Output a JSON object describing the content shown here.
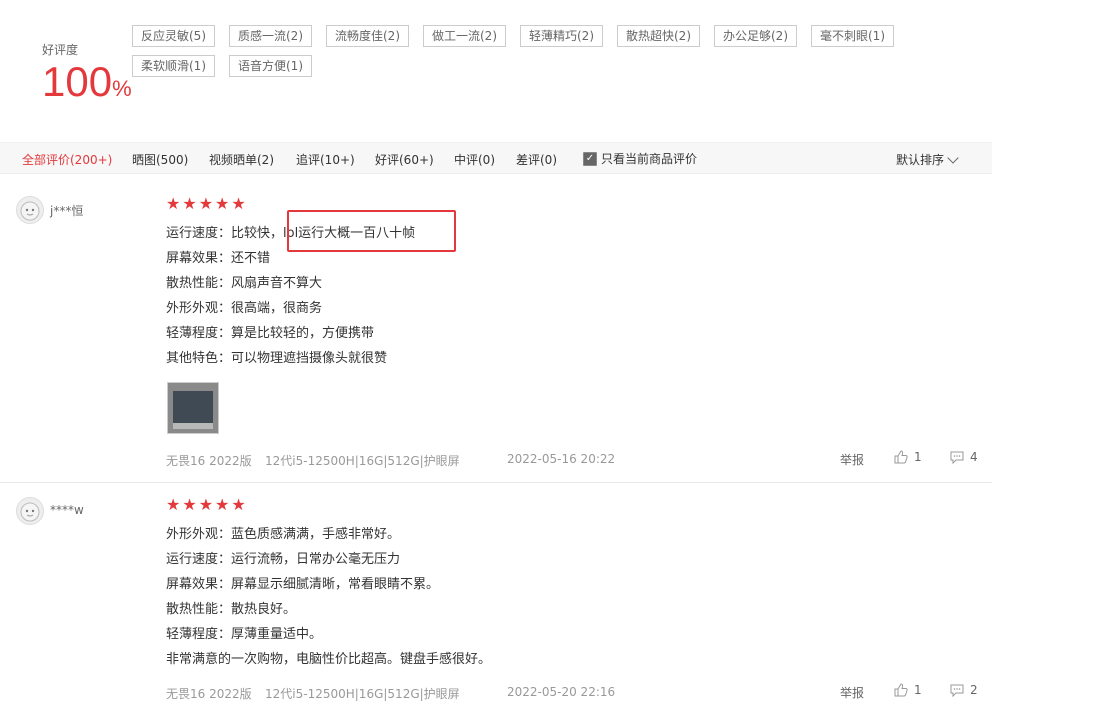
{
  "summary": {
    "rate_label": "好评度",
    "rate_value": "100",
    "rate_unit": "%",
    "tags": [
      "反应灵敏(5)",
      "质感一流(2)",
      "流畅度佳(2)",
      "做工一流(2)",
      "轻薄精巧(2)",
      "散热超快(2)",
      "办公足够(2)",
      "毫不刺眼(1)",
      "柔软顺滑(1)",
      "语音方便(1)"
    ]
  },
  "filters": {
    "items": [
      "全部评价(200+)",
      "晒图(500)",
      "视频晒单(2)",
      "追评(10+)",
      "好评(60+)",
      "中评(0)",
      "差评(0)"
    ],
    "only_current_label": "只看当前商品评价",
    "only_current_checked": true,
    "sort_label": "默认排序"
  },
  "reviews": [
    {
      "username": "j***恒",
      "stars": 5,
      "lines": [
        "运行速度：比较快，lol运行大概一百八十帧",
        "屏幕效果：还不错",
        "散热性能：风扇声音不算大",
        "外形外观：很高端，很商务",
        "轻薄程度：算是比较轻的，方便携带",
        "其他特色：可以物理遮挡摄像头就很赞"
      ],
      "has_image": true,
      "version": "无畏16 2022版",
      "spec": "12代i5-12500H|16G|512G|护眼屏",
      "date": "2022-05-16 20:22",
      "report_label": "举报",
      "likes": "1",
      "comments": "4"
    },
    {
      "username": "****w",
      "stars": 5,
      "lines": [
        "外形外观：蓝色质感满满，手感非常好。",
        "运行速度：运行流畅，日常办公毫无压力",
        "屏幕效果：屏幕显示细腻清晰，常看眼睛不累。",
        "散热性能：散热良好。",
        "轻薄程度：厚薄重量适中。",
        "非常满意的一次购物，电脑性价比超高。键盘手感很好。"
      ],
      "version": "无畏16 2022版",
      "spec": "12代i5-12500H|16G|512G|护眼屏",
      "date": "2022-05-20 22:16",
      "report_label": "举报",
      "likes": "1",
      "comments": "2"
    }
  ]
}
